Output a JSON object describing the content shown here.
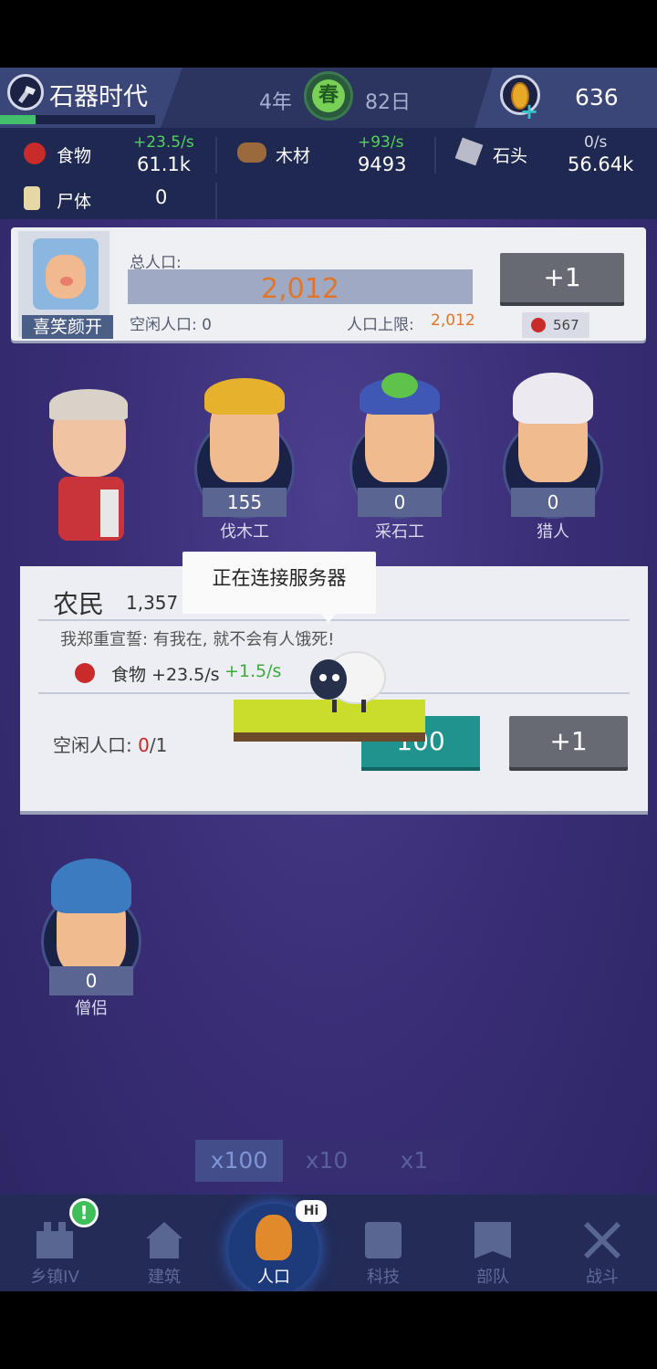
{
  "header": {
    "age_title": "石器时代",
    "age_progress": 0.23,
    "year": "4年",
    "season": "春",
    "day": "82日",
    "coins": "636"
  },
  "resources": {
    "food": {
      "label": "食物",
      "rate": "+23.5/s",
      "value": "61.1k"
    },
    "wood": {
      "label": "木材",
      "rate": "+93/s",
      "value": "9493"
    },
    "stone": {
      "label": "石头",
      "rate": "0/s",
      "value": "56.64k"
    },
    "corpse": {
      "label": "尸体",
      "value": "0"
    }
  },
  "leader": {
    "name": "喜笑颜开",
    "total_pop_label": "总人口:",
    "total_pop_value": "2,012",
    "idle_label": "空闲人口: 0",
    "cap_label": "人口上限:",
    "cap_value": "2,012",
    "plus_label": "+1",
    "cost": "567"
  },
  "workers": [
    {
      "name": "伐木工",
      "count": "155"
    },
    {
      "name": "采石工",
      "count": "0"
    },
    {
      "name": "猎人",
      "count": "0"
    }
  ],
  "farmer": {
    "title": "农民",
    "count": "1,357",
    "motto": "我郑重宣誓: 有我在, 就不会有人饿死!",
    "food_label": "食物 +23.5/s",
    "food_bonus": "+1.5/s",
    "idle_label": "空闲人口: ",
    "idle_current": "0",
    "idle_total": "/1",
    "buy_label": "100",
    "plus_label": "+1"
  },
  "loading": {
    "message": "正在连接服务器"
  },
  "monk": {
    "name": "僧侣",
    "count": "0"
  },
  "multipliers": [
    "x100",
    "x10",
    "x1"
  ],
  "nav": [
    {
      "label": "乡镇IV",
      "alert": "!"
    },
    {
      "label": "建筑"
    },
    {
      "label": "人口",
      "bubble": "Hi"
    },
    {
      "label": "科技"
    },
    {
      "label": "部队"
    },
    {
      "label": "战斗"
    }
  ],
  "colors": {
    "accent_orange": "#e0762b",
    "green": "#55d05a",
    "teal": "#20938f"
  }
}
